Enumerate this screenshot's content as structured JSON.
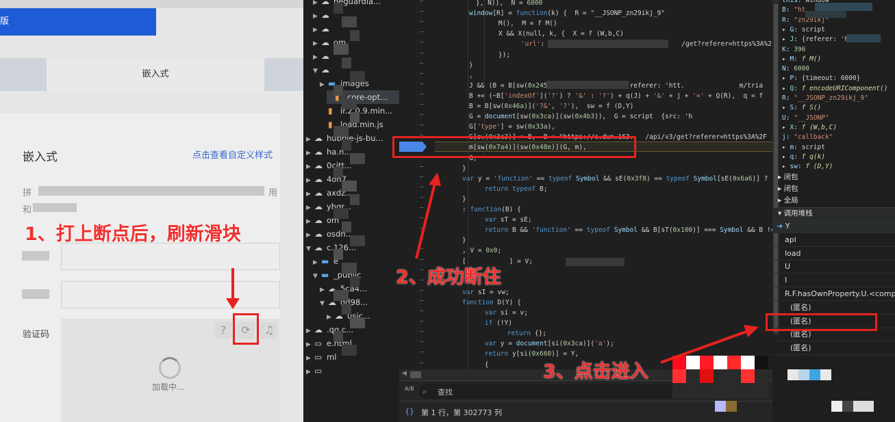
{
  "page": {
    "banner": "版",
    "tab_active": "嵌入式",
    "card_title": "嵌入式",
    "custom_style_link": "点击查看自定义样式",
    "desc_start": "拼",
    "desc_end": "用",
    "desc2_start": "和",
    "captcha_label": "验证码",
    "loading_text": "加载中..."
  },
  "tree": [
    {
      "label": "neguardia...",
      "depth": 3,
      "icon": "cloud",
      "expanded": false
    },
    {
      "label": "",
      "depth": 3,
      "icon": "cloud",
      "expanded": false
    },
    {
      "label": "",
      "depth": 3,
      "icon": "cloud",
      "expanded": false
    },
    {
      "label": "om",
      "depth": 3,
      "icon": "cloud",
      "expanded": false
    },
    {
      "label": "",
      "depth": 3,
      "icon": "cloud",
      "expanded": false
    },
    {
      "label": "",
      "depth": 3,
      "icon": "cloud",
      "expanded": true
    },
    {
      "label": "images",
      "depth": 4,
      "icon": "folder",
      "expanded": false
    },
    {
      "label": "core-opt...",
      "depth": 5,
      "icon": "js",
      "expanded": null
    },
    {
      "label": "ir.2.0.9.min...",
      "depth": 4,
      "icon": "js",
      "expanded": null
    },
    {
      "label": "load.min.js",
      "depth": 4,
      "icon": "js",
      "expanded": null
    },
    {
      "label": "hubble-js-bu...",
      "depth": 2,
      "icon": "cloud",
      "expanded": false
    },
    {
      "label": "ha.n...",
      "depth": 2,
      "icon": "cloud",
      "expanded": false
    },
    {
      "label": "0citt...",
      "depth": 2,
      "icon": "cloud",
      "expanded": false
    },
    {
      "label": "4oh7...",
      "depth": 2,
      "icon": "cloud",
      "expanded": false
    },
    {
      "label": "axdz...",
      "depth": 2,
      "icon": "cloud",
      "expanded": false
    },
    {
      "label": "yhqr...",
      "depth": 2,
      "icon": "cloud",
      "expanded": false
    },
    {
      "label": "om",
      "depth": 2,
      "icon": "cloud",
      "expanded": false
    },
    {
      "label": "osdn...",
      "depth": 2,
      "icon": "cloud",
      "expanded": false
    },
    {
      "label": "c.126...",
      "depth": 2,
      "icon": "cloud",
      "expanded": true
    },
    {
      "label": "e",
      "depth": 3,
      "icon": "folder",
      "expanded": false
    },
    {
      "label": "_public",
      "depth": 3,
      "icon": "folder",
      "expanded": true
    },
    {
      "label": "5ca4...",
      "depth": 4,
      "icon": "cloud",
      "expanded": false
    },
    {
      "label": "dd98...",
      "depth": 4,
      "icon": "cloud",
      "expanded": true
    },
    {
      "label": "usic...",
      "depth": 5,
      "icon": "cloud",
      "expanded": false
    },
    {
      "label": ".qq.c...",
      "depth": 2,
      "icon": "cloud",
      "expanded": false
    },
    {
      "label": "e.html",
      "depth": 2,
      "icon": "frame",
      "expanded": false
    },
    {
      "label": "ml",
      "depth": 2,
      "icon": "frame",
      "expanded": false
    },
    {
      "label": "",
      "depth": 2,
      "icon": "frame",
      "expanded": false
    }
  ],
  "code": [
    "}, N)),  N = 6000",
    "window[R] = function(k) {  R = \"__JSONP_zn29ikj_9\"",
    "    M(),  M = f M()",
    "    X && X(null, k, {  X = f (W,b,C)",
    "        'url': B  B = \"                          /get?referer=https%3A%2F",
    "    });",
    "}",
    ",",
    "J && (B = B[sw(0x245)]('?')[0x0]),  J = {referer: 'htt.              m/tria",
    "B += (~B['indexOf']('?') ? '&' : '?') + q(J) + '&' + j + '=' + Q(R),  q = f",
    "B = B[sw(0x46a)]('?&', '?'),  sw = f (D,Y)",
    "G = document[sw(0x3ca)](sw(0x4b3)),  G = script  {src: 'h",
    "G['type'] = sw(0x33a),",
    "G[sw(0x3c3)] = B,  B = \"https://c.dun.163.   /api/v3/get?referer=https%3A%2F",
    "m[sw(0x7a4)](sw(0x48e)](G, m),",
    "G;",
    "}",
    "var y = 'function' == typeof Symbol && sE(0x3f8) == typeof Symbol[sE(0x6a6)] ? :",
    "    return typeof B;",
    "}",
    ": function(B) {",
    "    var sT = sE;",
    "    return B && 'function' == typeof Symbol && B[sT(0x100)] === Symbol && B !==",
    "}",
    ", V = 0x0;",
    "[           ] = V;",
    "",
    "",
    "var sI = vw;",
    "function D(Y) {",
    "    var si = v;",
    "    if (!Y)",
    "        return {};",
    "    var y = document[si(0x3ca)]('a');",
    "    return y[si(0x660)] = Y,",
    "    {"
  ],
  "search": {
    "placeholder": "查找",
    "match_case_icon": "A/B"
  },
  "status": "第 1 行，第 302773 列",
  "scope": [
    {
      "k": "this",
      "v": "Window",
      "t": "obj",
      "arrow": false
    },
    {
      "k": "B",
      "v": "\"ht",
      "t": "str",
      "arrow": false
    },
    {
      "k": "R",
      "v": "\"zn29ikj\"",
      "t": "str",
      "arrow": false
    },
    {
      "k": "G",
      "v": "script",
      "t": "obj",
      "arrow": true
    },
    {
      "k": "J",
      "v": "{referer: 'h",
      "t": "obj",
      "arrow": true
    },
    {
      "k": "K",
      "v": "396",
      "t": "num",
      "arrow": false
    },
    {
      "k": "M",
      "v": "f M()",
      "t": "fn",
      "arrow": true
    },
    {
      "k": "N",
      "v": "6000",
      "t": "num",
      "arrow": false
    },
    {
      "k": "P",
      "v": "{timeout: 6000}",
      "t": "obj",
      "arrow": true
    },
    {
      "k": "Q",
      "v": "f encodeURIComponent()",
      "t": "fn",
      "arrow": true
    },
    {
      "k": "R",
      "v": "\"__JSONP_zn29ikj_9\"",
      "t": "str",
      "arrow": false
    },
    {
      "k": "S",
      "v": "f S()",
      "t": "fn",
      "arrow": true
    },
    {
      "k": "U",
      "v": "\"__JSONP\"",
      "t": "str",
      "arrow": false
    },
    {
      "k": "X",
      "v": "f (W,b,C)",
      "t": "fn",
      "arrow": true
    },
    {
      "k": "j",
      "v": "\"callback\"",
      "t": "str",
      "arrow": false
    },
    {
      "k": "m",
      "v": "script",
      "t": "obj",
      "arrow": true
    },
    {
      "k": "q",
      "v": "f q(k)",
      "t": "fn",
      "arrow": true
    },
    {
      "k": "sw",
      "v": "f (D,Y)",
      "t": "fn",
      "arrow": true
    }
  ],
  "scope_sections": [
    "闭包",
    "闭包",
    "全局"
  ],
  "callstack_title": "调用堆栈",
  "callstack": [
    {
      "label": "Y",
      "active": true,
      "anon": false
    },
    {
      "label": "api",
      "active": false,
      "anon": false
    },
    {
      "label": "load",
      "active": false,
      "anon": false
    },
    {
      "label": "U",
      "active": false,
      "anon": false
    },
    {
      "label": "I",
      "active": false,
      "anon": false
    },
    {
      "label": "R.F.hasOwnProperty.U.<comput",
      "active": false,
      "anon": false
    },
    {
      "label": "(匿名)",
      "active": false,
      "anon": true
    },
    {
      "label": "(匿名)",
      "active": false,
      "anon": true
    },
    {
      "label": "(匿名)",
      "active": false,
      "anon": true
    },
    {
      "label": "(匿名)",
      "active": false,
      "anon": true
    }
  ],
  "annotations": {
    "step1": "1、打上断点后，刷新滑块",
    "step2": "2、成功断住",
    "step3": "3、点击进入"
  },
  "colors": {
    "annotation": "#e8221f",
    "breakpoint": "#4a86e8",
    "banner": "#1e5bd6"
  }
}
